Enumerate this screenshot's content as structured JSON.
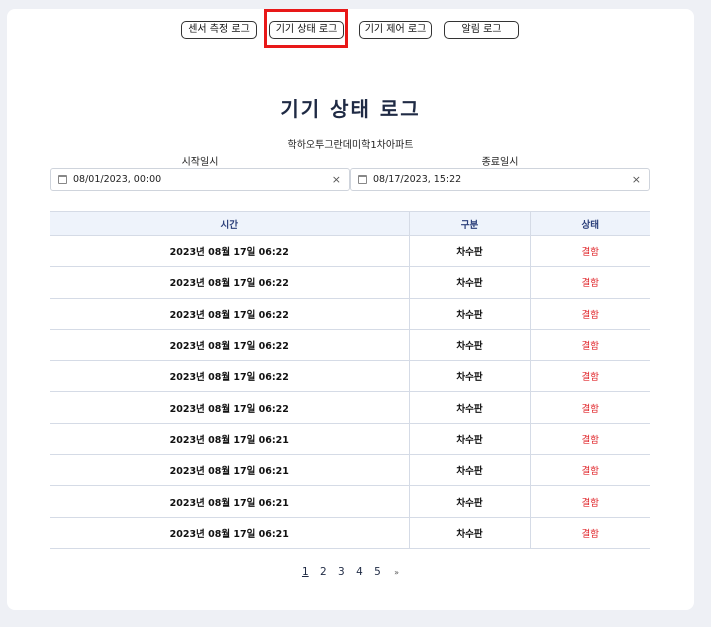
{
  "tabs": [
    {
      "label": "센서 측정 로그"
    },
    {
      "label": "기기 상태 로그"
    },
    {
      "label": "기기 제어 로그"
    },
    {
      "label": "알림 로그"
    }
  ],
  "page_title": "기기 상태 로그",
  "site_name": "학하오투그란데미학1차아파트",
  "filters": {
    "start_label": "시작일시",
    "start_value": "08/01/2023, 00:00",
    "end_label": "종료일시",
    "end_value": "08/17/2023, 15:22",
    "clear_symbol": "×"
  },
  "table": {
    "headers": [
      "시간",
      "구분",
      "상태"
    ],
    "rows": [
      [
        "2023년 08월 17일 06:22",
        "차수판",
        "결함"
      ],
      [
        "2023년 08월 17일 06:22",
        "차수판",
        "결함"
      ],
      [
        "2023년 08월 17일 06:22",
        "차수판",
        "결함"
      ],
      [
        "2023년 08월 17일 06:22",
        "차수판",
        "결함"
      ],
      [
        "2023년 08월 17일 06:22",
        "차수판",
        "결함"
      ],
      [
        "2023년 08월 17일 06:22",
        "차수판",
        "결함"
      ],
      [
        "2023년 08월 17일 06:21",
        "차수판",
        "결함"
      ],
      [
        "2023년 08월 17일 06:21",
        "차수판",
        "결함"
      ],
      [
        "2023년 08월 17일 06:21",
        "차수판",
        "결함"
      ],
      [
        "2023년 08월 17일 06:21",
        "차수판",
        "결함"
      ]
    ]
  },
  "pagination": {
    "pages": [
      "1",
      "2",
      "3",
      "4",
      "5"
    ],
    "current": "1",
    "next": "»"
  },
  "colors": {
    "status_fault": "#e0262b",
    "highlight": "#e81818",
    "header_text": "#2b3f7a"
  }
}
